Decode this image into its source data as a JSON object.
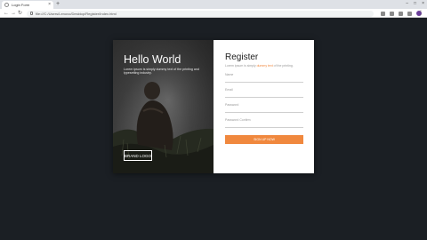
{
  "browser": {
    "tab_title": "Login Form",
    "tab_close": "×",
    "new_tab": "+",
    "url": "file:///C:/Users/Lenovo/Desktop/Register/Index.html",
    "nav_back": "←",
    "nav_forward": "→",
    "nav_reload": "↻",
    "menu": "⋮",
    "window_minimize": "–",
    "window_maximize": "□",
    "window_close": "×"
  },
  "hero": {
    "title": "Hello World",
    "subtitle": "Lorem ipsum is simply dummy text of the printing and typesetting industry.",
    "brand_label": "BRAND LOGO"
  },
  "form": {
    "title": "Register",
    "subtitle_prefix": "Lorem ipsum is simply ",
    "subtitle_link": "dummy text",
    "subtitle_suffix": " of the printing.",
    "fields": [
      {
        "placeholder": "Name"
      },
      {
        "placeholder": "Email"
      },
      {
        "placeholder": "Password"
      },
      {
        "placeholder": "Password Confirm"
      }
    ],
    "submit_label": "SIGN UP NOW"
  },
  "colors": {
    "accent": "#f0883e",
    "page_background": "#1b1f24",
    "card_background": "#ffffff"
  }
}
